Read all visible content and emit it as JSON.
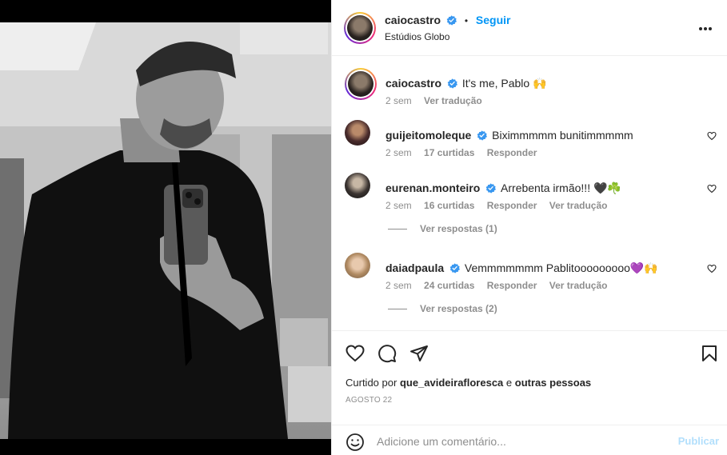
{
  "post": {
    "author": "caiocastro",
    "follow_label": "Seguir",
    "dot": "•",
    "location": "Estúdios Globo",
    "caption": "It's me, Pablo 🙌",
    "caption_time": "2 sem",
    "caption_translate": "Ver tradução"
  },
  "comments": [
    {
      "user": "guijeitomoleque",
      "text": "Biximmmmm bunitimmmmm",
      "time": "2 sem",
      "likes": "17 curtidas",
      "reply": "Responder",
      "translate": ""
    },
    {
      "user": "eurenan.monteiro",
      "text": "Arrebenta irmão!!! 🖤☘️",
      "time": "2 sem",
      "likes": "16 curtidas",
      "reply": "Responder",
      "translate": "Ver tradução",
      "view_replies": "Ver respostas (1)"
    },
    {
      "user": "daiadpaula",
      "text": "Vemmmmmmm Pablitooooooooo💜🙌",
      "time": "2 sem",
      "likes": "24 curtidas",
      "reply": "Responder",
      "translate": "Ver tradução",
      "view_replies": "Ver respostas (2)"
    }
  ],
  "footer": {
    "liked_prefix": "Curtido por",
    "liked_user": "que_avideiraflorescа",
    "liked_and": "e",
    "liked_others": "outras pessoas",
    "date": "AGOSTO 22"
  },
  "comment_box": {
    "placeholder": "Adicione um comentário...",
    "publish_label": "Publicar"
  },
  "icons": {
    "verified": "verified-badge-icon",
    "like": "heart-icon",
    "comment": "comment-icon",
    "share": "paper-plane-icon",
    "save": "bookmark-icon",
    "emoji": "smiley-icon",
    "more": "more-options-icon"
  },
  "colors": {
    "accent": "#0095f6",
    "verified": "#3897f0",
    "muted": "#8e8e8e",
    "publish_disabled": "#b2dffc"
  }
}
